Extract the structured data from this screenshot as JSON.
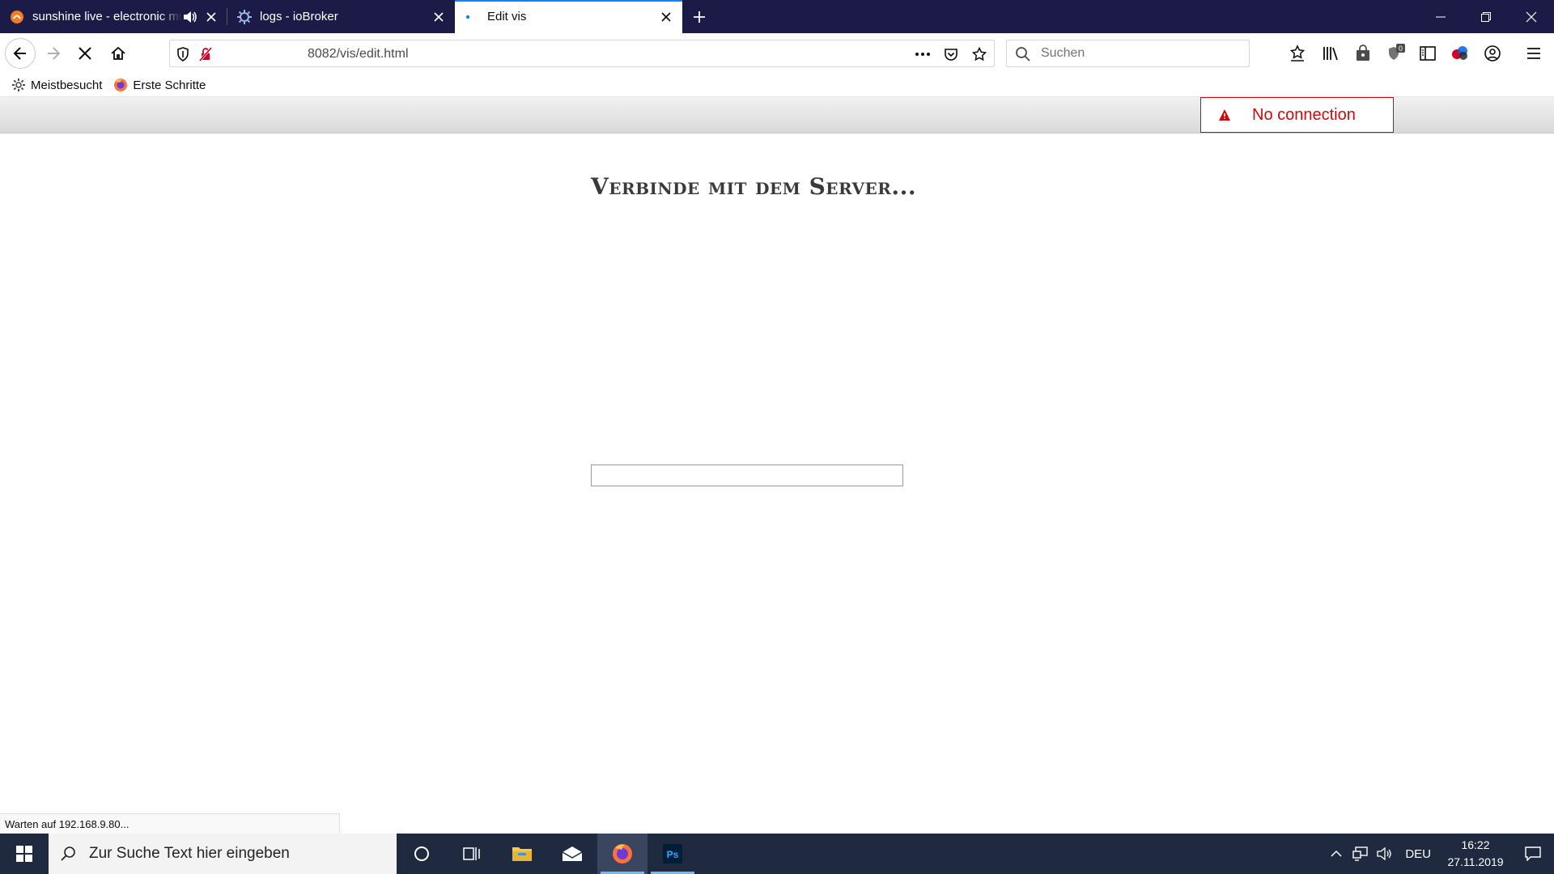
{
  "tabs": [
    {
      "title": "sunshine live - electronic music radio",
      "active": false
    },
    {
      "title": "logs - ioBroker",
      "active": false
    },
    {
      "title": "Edit vis",
      "active": true
    }
  ],
  "navbar": {
    "url": "8082/vis/edit.html",
    "search_placeholder": "Suchen",
    "badge_count": "0"
  },
  "bookmarks": [
    {
      "label": "Meistbesucht"
    },
    {
      "label": "Erste Schritte"
    }
  ],
  "page": {
    "alert_text": "No connection",
    "heading": "Verbinde mit dem Server...",
    "progress": 0
  },
  "status": {
    "text": "Warten auf 192.168.9.80..."
  },
  "taskbar": {
    "search_placeholder": "Zur Suche Text hier eingeben",
    "lang": "DEU",
    "time": "16:22",
    "date": "27.11.2019"
  },
  "colors": {
    "tabstrip": "#1c1b48",
    "accent": "#0a84ff",
    "alert": "#cd0a0a",
    "taskbar": "#1f2a40"
  }
}
